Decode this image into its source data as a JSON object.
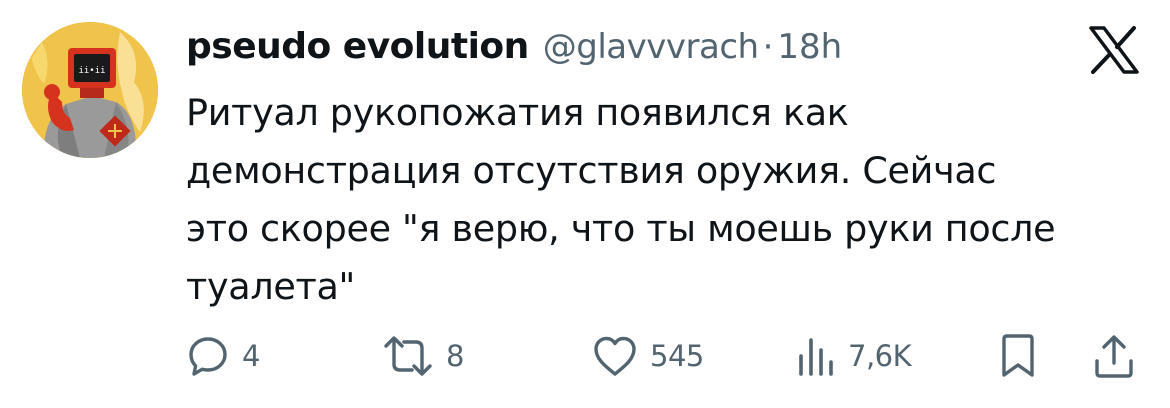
{
  "author": {
    "display_name": "pseudo evolution",
    "handle": "@glavvvrach",
    "separator": "·",
    "time": "18h"
  },
  "tweet": {
    "text": "Ритуал рукопожатия появился как\nдемонстрация отсутствия оружия. Сейчас\nэто скорее \"я верю, что ты моешь руки после\nтуалета\""
  },
  "actions": {
    "replies": "4",
    "reposts": "8",
    "likes": "545",
    "views": "7,6K"
  },
  "icons": {
    "brand": "x-logo-icon",
    "reply": "reply-icon",
    "repost": "repost-icon",
    "like": "heart-icon",
    "views": "views-chart-icon",
    "bookmark": "bookmark-icon",
    "share": "share-icon"
  },
  "colors": {
    "text": "#0f1419",
    "secondary": "#536471",
    "avatar_bg": "#f0c34a"
  }
}
